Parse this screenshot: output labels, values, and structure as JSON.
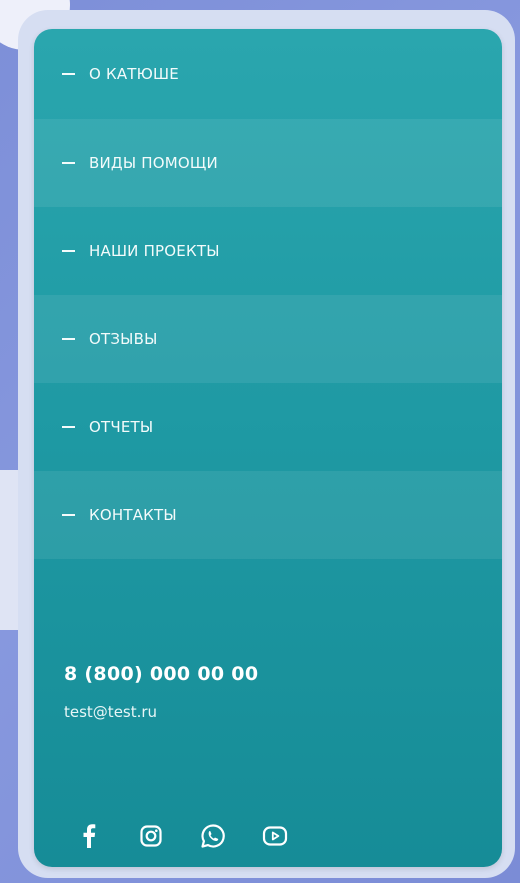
{
  "menu": {
    "items": [
      {
        "label": "О КАТЮШЕ"
      },
      {
        "label": "ВИДЫ ПОМОЩИ"
      },
      {
        "label": "НАШИ ПРОЕКТЫ"
      },
      {
        "label": "ОТЗЫВЫ"
      },
      {
        "label": "ОТЧЕТЫ"
      },
      {
        "label": "КОНТАКТЫ"
      }
    ]
  },
  "contacts": {
    "phone": "8 (800) 000 00 00",
    "email": "test@test.ru"
  },
  "socials": [
    {
      "icon": "facebook-icon"
    },
    {
      "icon": "instagram-icon"
    },
    {
      "icon": "whatsapp-icon"
    },
    {
      "icon": "youtube-icon"
    }
  ],
  "colors": {
    "panel_top": "#2aa6ae",
    "panel_bottom": "#168c97",
    "background": "#7d8fd8",
    "frame": "#d6def2",
    "text": "#ffffff"
  }
}
